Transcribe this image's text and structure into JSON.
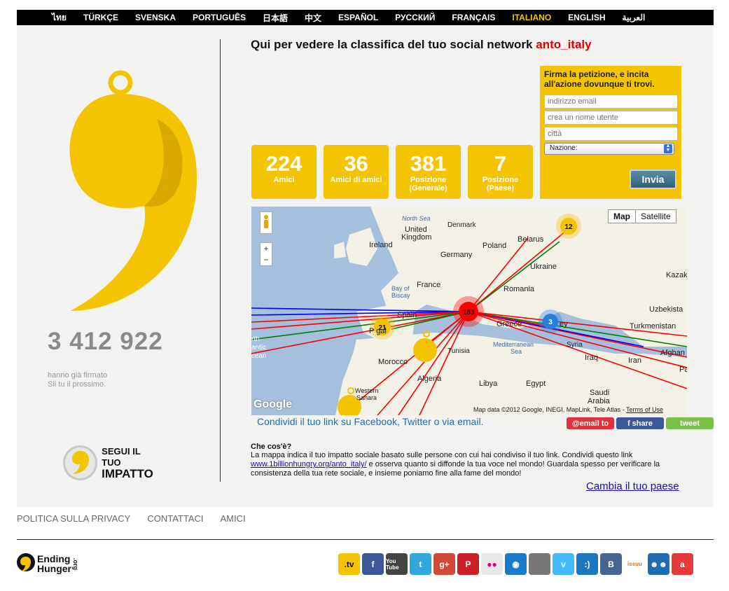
{
  "languages": [
    "ไทย",
    "TÜRKÇE",
    "SVENSKA",
    "PORTUGUÊS",
    "日本語",
    "中文",
    "ESPAÑOL",
    "РУССКИЙ",
    "FRANÇAIS",
    "ITALIANO",
    "ENGLISH",
    "العربية"
  ],
  "active_language": "ITALIANO",
  "left": {
    "count": "3 412 922",
    "signed_line1": "hanno già firmato",
    "signed_line2": "Sii tu il prossimo.",
    "follow_line1": "SEGUI IL TUO",
    "follow_line2": "IMPATTO"
  },
  "headline": {
    "text": "Qui per vedere la classifica del tuo social network",
    "user": "anto_italy"
  },
  "petition": {
    "title": "Firma la petizione, e incita all'azione dovunque ti trovi.",
    "email_placeholder": "indirizzo email",
    "username_placeholder": "crea un nome utente",
    "city_placeholder": "città",
    "country_select": "Nazione:",
    "submit": "Invia"
  },
  "stats": [
    {
      "value": "224",
      "label": "Amici",
      "label2": ""
    },
    {
      "value": "36",
      "label": "Amici di amici",
      "label2": ""
    },
    {
      "value": "381",
      "label": "Posizione",
      "label2": "(Generale)"
    },
    {
      "value": "7",
      "label": "Posizione",
      "label2": "(Paese)"
    }
  ],
  "map": {
    "type_map": "Map",
    "type_satellite": "Satellite",
    "zoom_in": "+",
    "zoom_out": "−",
    "google": "Google",
    "attribution": "Map data ©2012 Google, INEGI, MapLink, Tele Atlas -",
    "terms": "Terms of Use",
    "clusters": [
      "183",
      "21",
      "12",
      "3"
    ],
    "labels": {
      "north_sea": "North Sea",
      "denmark": "Denmark",
      "united": "United",
      "kingdom": "Kingdom",
      "belarus": "Belarus",
      "ireland": "Ireland",
      "poland": "Poland",
      "germany": "Germany",
      "ukraine": "Ukraine",
      "kazak": "Kazak",
      "bay": "Bay of",
      "biscay": "Biscay",
      "france": "France",
      "romania": "Romania",
      "uzbekista": "Uzbekista",
      "spain": "Spain",
      "greece": "Greece",
      "turkey": "ey",
      "turkmenistan": "Turkmenistan",
      "portugal": "P     gal",
      "north": "rth",
      "antic": "antic",
      "cean": "cean",
      "tunisia": "Tunisia",
      "mediterranean": "Mediterranean",
      "sea": "Sea",
      "syria": "Syria",
      "afghan": "Afghan",
      "morocco": "Morocco",
      "iraq": "Iraq",
      "iran": "Iran",
      "pa": "Pa",
      "algeria": "Algeria",
      "libya": "Libya",
      "egypt": "Egypt",
      "saudi": "Saudi",
      "arabia": "Arabia",
      "western": "Western",
      "sahara": "Sahara"
    }
  },
  "share": {
    "text": "Condividi il tuo link su Facebook, Twitter o via email.",
    "email": "@email to",
    "facebook": "f  share",
    "tweet": "tweet"
  },
  "info": {
    "title": "Che cos'è?",
    "body1": "La mappa indica il tuo impatto sociale basato sulle persone con cui hai condiviso il tuo link. Condividi questo link",
    "link": "www.1billionhungry.org/anto_italy/",
    "body2": " e osserva quanto si diffonde la tua voce nel mondo! Guardala spesso per verificare la consistenza della tua rete sociale, e insieme poniamo fine alla fame del mondo!",
    "change_country": "Cambia il tuo paese"
  },
  "footer": {
    "links": [
      "POLITICA SULLA PRIVACY",
      "CONTATTACI",
      "AMICI"
    ],
    "logo_line1": "Ending",
    "logo_line2": "Hunger",
    "logo_org": ".org",
    "social": [
      {
        "name": "tv-icon",
        "text": ".tv",
        "color": "#f5c400",
        "fg": "#111"
      },
      {
        "name": "facebook-icon",
        "text": "f",
        "color": "#3b5998",
        "fg": "#fff"
      },
      {
        "name": "youtube-icon",
        "text": "You Tube",
        "color": "#444444",
        "fg": "#fff"
      },
      {
        "name": "twitter-icon",
        "text": "t",
        "color": "#2fa8de",
        "fg": "#fff"
      },
      {
        "name": "google-plus-icon",
        "text": "g+",
        "color": "#d34836",
        "fg": "#fff"
      },
      {
        "name": "pinterest-icon",
        "text": "P",
        "color": "#cb2027",
        "fg": "#fff"
      },
      {
        "name": "flickr-icon",
        "text": "●●",
        "color": "#e8e8e8",
        "fg": "#e3007a"
      },
      {
        "name": "podcast-icon",
        "text": "◉",
        "color": "#1b7bc7",
        "fg": "#fff"
      },
      {
        "name": "itunes-icon",
        "text": "",
        "color": "#777777",
        "fg": "#fff"
      },
      {
        "name": "vimeo-icon",
        "text": "v",
        "color": "#44bbff",
        "fg": "#fff"
      },
      {
        "name": "myspace-icon",
        "text": ":)",
        "color": "#1d77c0",
        "fg": "#fff"
      },
      {
        "name": "vk-icon",
        "text": "B",
        "color": "#45668e",
        "fg": "#fff"
      },
      {
        "name": "issuu-icon",
        "text": "issuu",
        "color": "#ffffff",
        "fg": "#e86c1f"
      },
      {
        "name": "friends-icon",
        "text": "☻☻",
        "color": "#1f6cb0",
        "fg": "#fff"
      },
      {
        "name": "a-icon",
        "text": "a",
        "color": "#e73b3b",
        "fg": "#fff"
      }
    ]
  },
  "colors": {
    "accent": "#f5c400",
    "link": "#1a0dab",
    "user": "#e00000"
  }
}
